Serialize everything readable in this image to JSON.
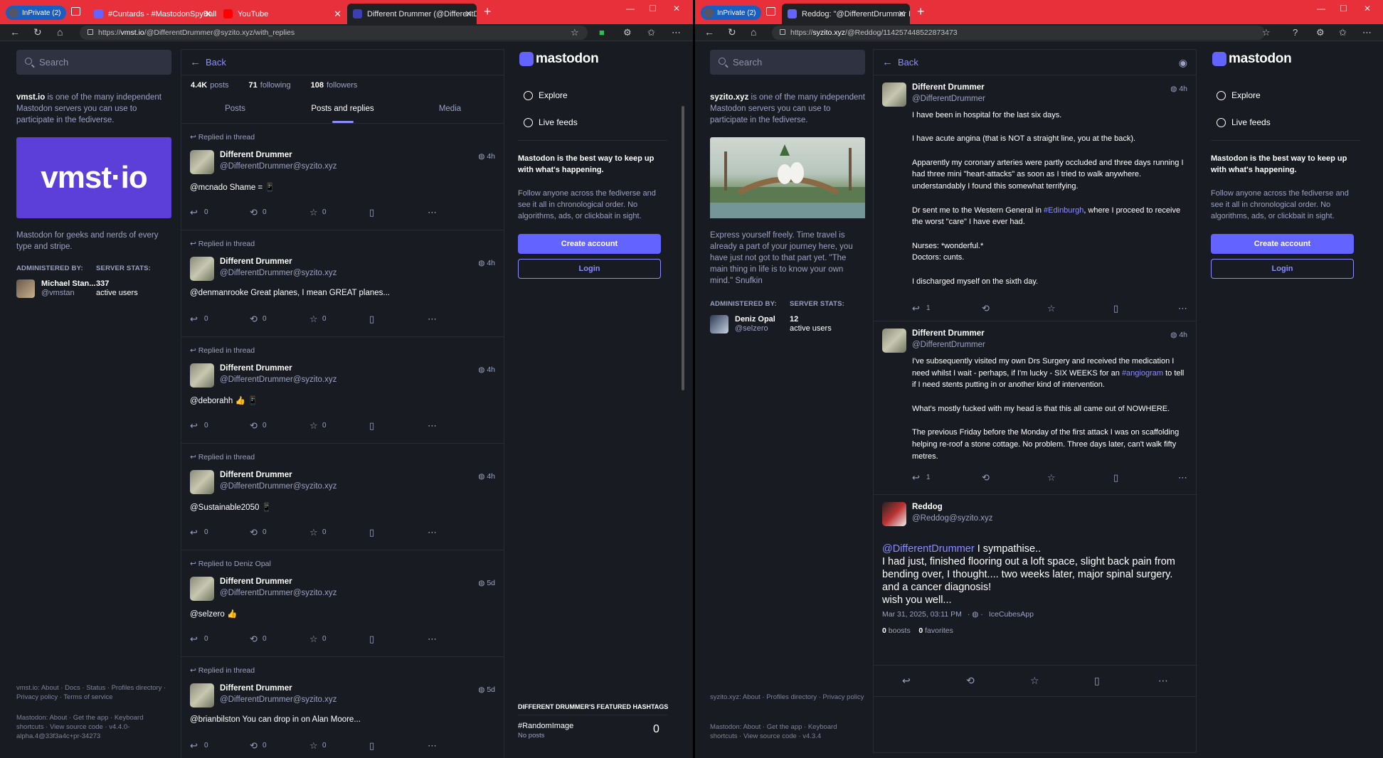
{
  "left": {
    "tabs": {
      "inprivate": "InPrivate (2)",
      "t1": "#Cuntards - #MastodonSpyBalloo",
      "t2": "YouTube",
      "t3": "Different Drummer (@DifferentD"
    },
    "url_prefix": "https://",
    "url_host": "vmst.io",
    "url_path": "/@DifferentDrummer@syzito.xyz/with_replies",
    "search_placeholder": "Search",
    "about_server": "vmst.io",
    "about_text": " is one of the many independent Mastodon servers you can use to participate in the fediverse.",
    "hero_logo": "vmst·io",
    "desc": "Mastodon for geeks and nerds of every type and stripe.",
    "administered_by": "ADMINISTERED BY:",
    "server_stats": "SERVER STATS:",
    "admin_name": "Michael Stan...",
    "admin_handle": "@vmstan",
    "stat_num": "337",
    "stat_label": "active users",
    "footer1": "vmst.io: About · Docs · Status · Profiles directory · Privacy policy · Terms of service",
    "footer2": "Mastodon: About · Get the app · Keyboard shortcuts · View source code · v4.4.0-alpha.4@33f3a4c+pr-34273",
    "back": "Back",
    "stats": {
      "posts_n": "4.4K",
      "posts_l": "posts",
      "following_n": "71",
      "following_l": "following",
      "followers_n": "108",
      "followers_l": "followers"
    },
    "profile_tabs": [
      "Posts",
      "Posts and replies",
      "Media"
    ],
    "posts": [
      {
        "pre": "Replied in thread",
        "name": "Different Drummer",
        "handle": "@DifferentDrummer@syzito.xyz",
        "time": "4h",
        "body": "@mcnado Shame = 📱",
        "r": "0",
        "b": "0",
        "f": "0"
      },
      {
        "pre": "Replied in thread",
        "name": "Different Drummer",
        "handle": "@DifferentDrummer@syzito.xyz",
        "time": "4h",
        "body": "@denmanrooke Great planes, I mean GREAT planes...",
        "r": "0",
        "b": "0",
        "f": "0"
      },
      {
        "pre": "Replied in thread",
        "name": "Different Drummer",
        "handle": "@DifferentDrummer@syzito.xyz",
        "time": "4h",
        "body": "@deborahh 👍 📱",
        "r": "0",
        "b": "0",
        "f": "0"
      },
      {
        "pre": "Replied in thread",
        "name": "Different Drummer",
        "handle": "@DifferentDrummer@syzito.xyz",
        "time": "4h",
        "body": "@Sustainable2050 📱",
        "r": "0",
        "b": "0",
        "f": "0"
      },
      {
        "pre": "Replied to Deniz Opal",
        "name": "Different Drummer",
        "handle": "@DifferentDrummer@syzito.xyz",
        "time": "5d",
        "body": "@selzero 👍",
        "r": "0",
        "b": "0",
        "f": "0"
      },
      {
        "pre": "Replied in thread",
        "name": "Different Drummer",
        "handle": "@DifferentDrummer@syzito.xyz",
        "time": "5d",
        "body": "@brianbilston You can drop in on Alan Moore...",
        "r": "0",
        "b": "0",
        "f": "0"
      }
    ],
    "logo": "mastodon",
    "explore": "Explore",
    "live": "Live feeds",
    "pitch_bold": "Mastodon is the best way to keep up with what's happening.",
    "pitch": "Follow anyone across the fediverse and see it all in chronological order. No algorithms, ads, or clickbait in sight.",
    "create": "Create account",
    "login": "Login",
    "featured_head": "DIFFERENT DRUMMER'S FEATURED HASHTAGS",
    "featured_tag": "#RandomImage",
    "featured_sub": "No posts",
    "featured_count": "0"
  },
  "right": {
    "tabs": {
      "inprivate": "InPrivate (2)",
      "t1": "Reddog: \"@DifferentDrummer I s"
    },
    "url_prefix": "https://",
    "url_host": "syzito.xyz",
    "url_path": "/@Reddog/114257448522873473",
    "search_placeholder": "Search",
    "about_server": "syzito.xyz",
    "about_text": " is one of the many independent Mastodon servers you can use to participate in the fediverse.",
    "desc": "Express yourself freely. Time travel is already a part of your journey here, you have just not got to that part yet. \"The main thing in life is to know your own mind.\" Snufkin",
    "administered_by": "ADMINISTERED BY:",
    "server_stats": "SERVER STATS:",
    "admin_name": "Deniz Opal",
    "admin_handle": "@selzero",
    "stat_num": "12",
    "stat_label": "active users",
    "footer1": "syzito.xyz: About · Profiles directory · Privacy policy",
    "footer2": "Mastodon: About · Get the app · Keyboard shortcuts · View source code · v4.3.4",
    "back": "Back",
    "thread": [
      {
        "name": "Different Drummer",
        "handle": "@DifferentDrummer",
        "time": "4h",
        "paras": [
          "I have been in hospital for the last six days.",
          "I have acute angina (that is NOT a straight line, you at the back).",
          "Apparently my coronary arteries were partly occluded and three days running I had three mini \"heart-attacks\" as soon as I tried to walk anywhere. understandably I found this somewhat terrifying.",
          "Dr sent me to the Western General in #Edinburgh, where I proceed to receive the worst \"care\" I have ever had.",
          "Nurses: *wonderful.*\nDoctors: cunts.",
          "I discharged myself on the sixth day."
        ],
        "r": "1"
      },
      {
        "name": "Different Drummer",
        "handle": "@DifferentDrummer",
        "time": "4h",
        "paras": [
          "I've subsequently visited my own Drs Surgery and received the medication I need whilst I wait - perhaps, if I'm lucky - SIX WEEKS for an #angiogram to tell if I need stents putting in or another kind of intervention.",
          "What's mostly fucked with my head is that this all came out of NOWHERE.",
          "The previous Friday before the Monday of the first attack I was on scaffolding helping re-roof a stone cottage. No problem.  Three days later, can't walk fifty metres."
        ],
        "r": "1"
      }
    ],
    "focus": {
      "name": "Reddog",
      "handle": "@Reddog@syzito.xyz",
      "mention": "@DifferentDrummer",
      "body_first": " I sympathise..",
      "body_rest": "I had just, finished flooring out a loft space, slight back pain from bending over, I thought.... two weeks later, major spinal surgery.\nand a cancer diagnosis!\nwish you well...",
      "date": "Mar 31, 2025, 03:11 PM",
      "app": "IceCubesApp",
      "boosts_n": "0",
      "boosts_l": "boosts",
      "favs_n": "0",
      "favs_l": "favorites"
    },
    "logo": "mastodon",
    "explore": "Explore",
    "live": "Live feeds",
    "pitch_bold": "Mastodon is the best way to keep up with what's happening.",
    "pitch": "Follow anyone across the fediverse and see it all in chronological order. No algorithms, ads, or clickbait in sight.",
    "create": "Create account",
    "login": "Login"
  }
}
